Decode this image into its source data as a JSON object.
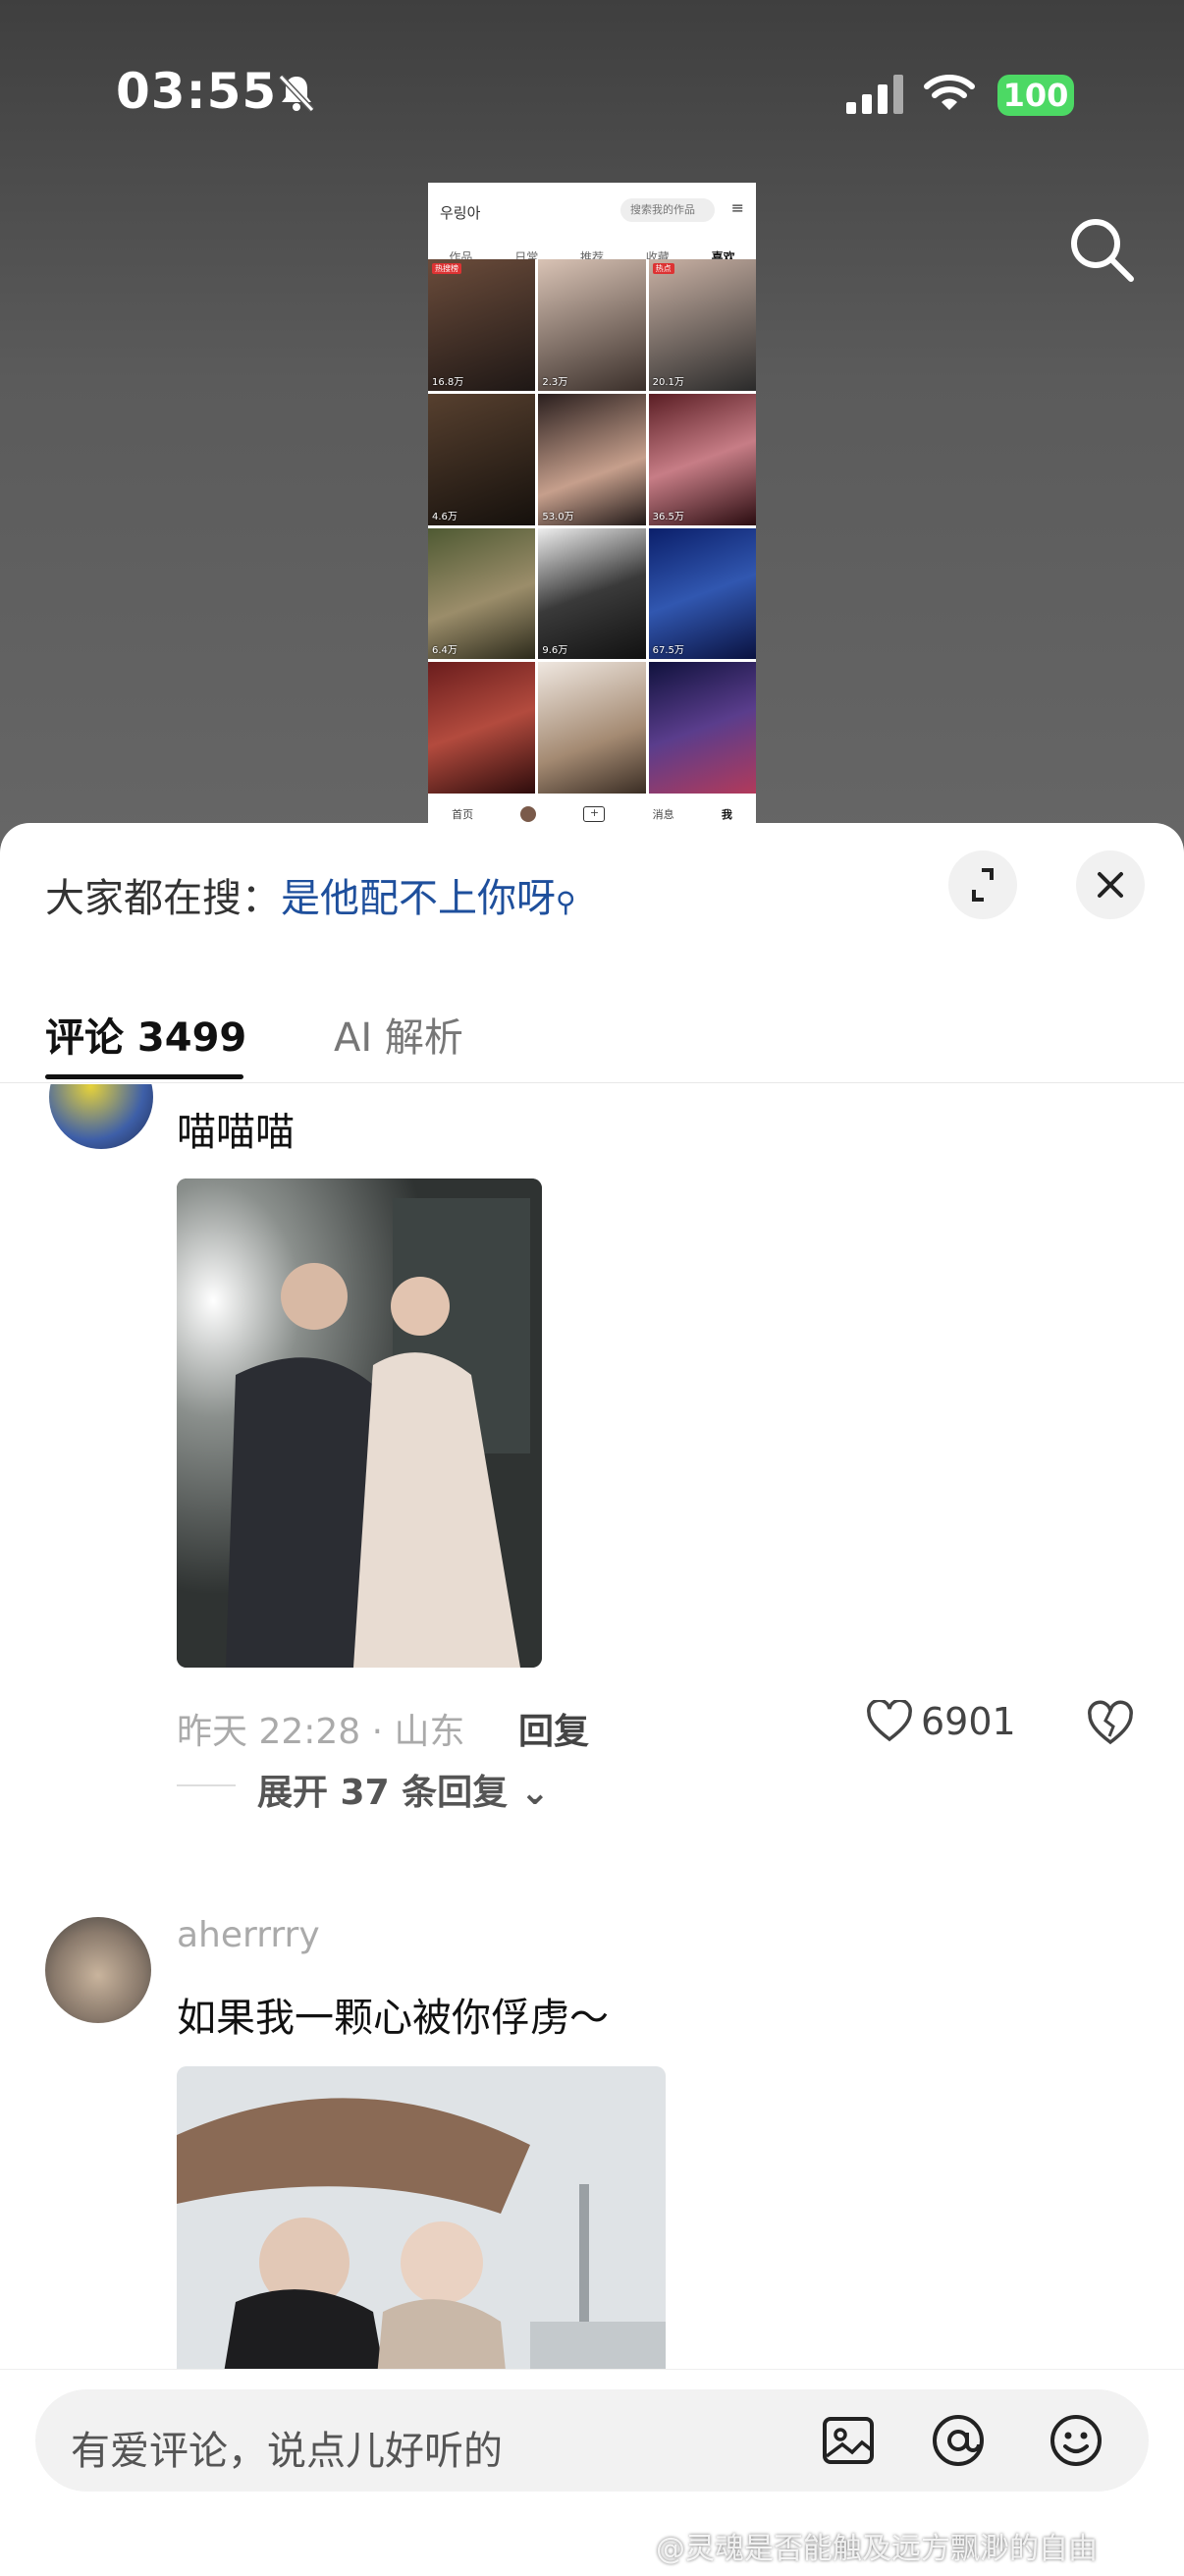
{
  "status_bar": {
    "time": "03:55",
    "battery": "100"
  },
  "mini_profile": {
    "name": "우링아",
    "search_placeholder": "搜索我的作品",
    "tabs": [
      "作品",
      "日常",
      "推荐",
      "收藏",
      "喜欢"
    ],
    "active_tab": "喜欢",
    "grid_counts": [
      "16.8万",
      "2.3万",
      "20.1万",
      "4.6万",
      "53.0万",
      "36.5万",
      "6.4万",
      "9.6万",
      "67.5万",
      "",
      "",
      ""
    ],
    "grid_tags": [
      "热搜榜",
      "",
      "热点",
      "",
      "",
      "",
      "",
      "",
      "",
      "",
      "",
      ""
    ],
    "nav": [
      "首页",
      "",
      "",
      "消息",
      "我"
    ]
  },
  "sheet": {
    "trend_prefix": "大家都在搜：",
    "trend_query": "是他配不上你呀",
    "tabs": {
      "comments": "评论 3499",
      "ai": "AI 解析"
    },
    "comment1": {
      "text": "喵喵喵",
      "meta": "昨天 22:28 · 山东",
      "reply": "回复",
      "likes": "6901",
      "more_replies": "展开 37 条回复"
    },
    "comment2": {
      "username": "aherrrry",
      "text": "如果我一颗心被你俘虏～"
    },
    "input_placeholder": "有爱评论，说点儿好听的"
  },
  "watermark": "@灵魂是否能触及远方飘渺的自由"
}
